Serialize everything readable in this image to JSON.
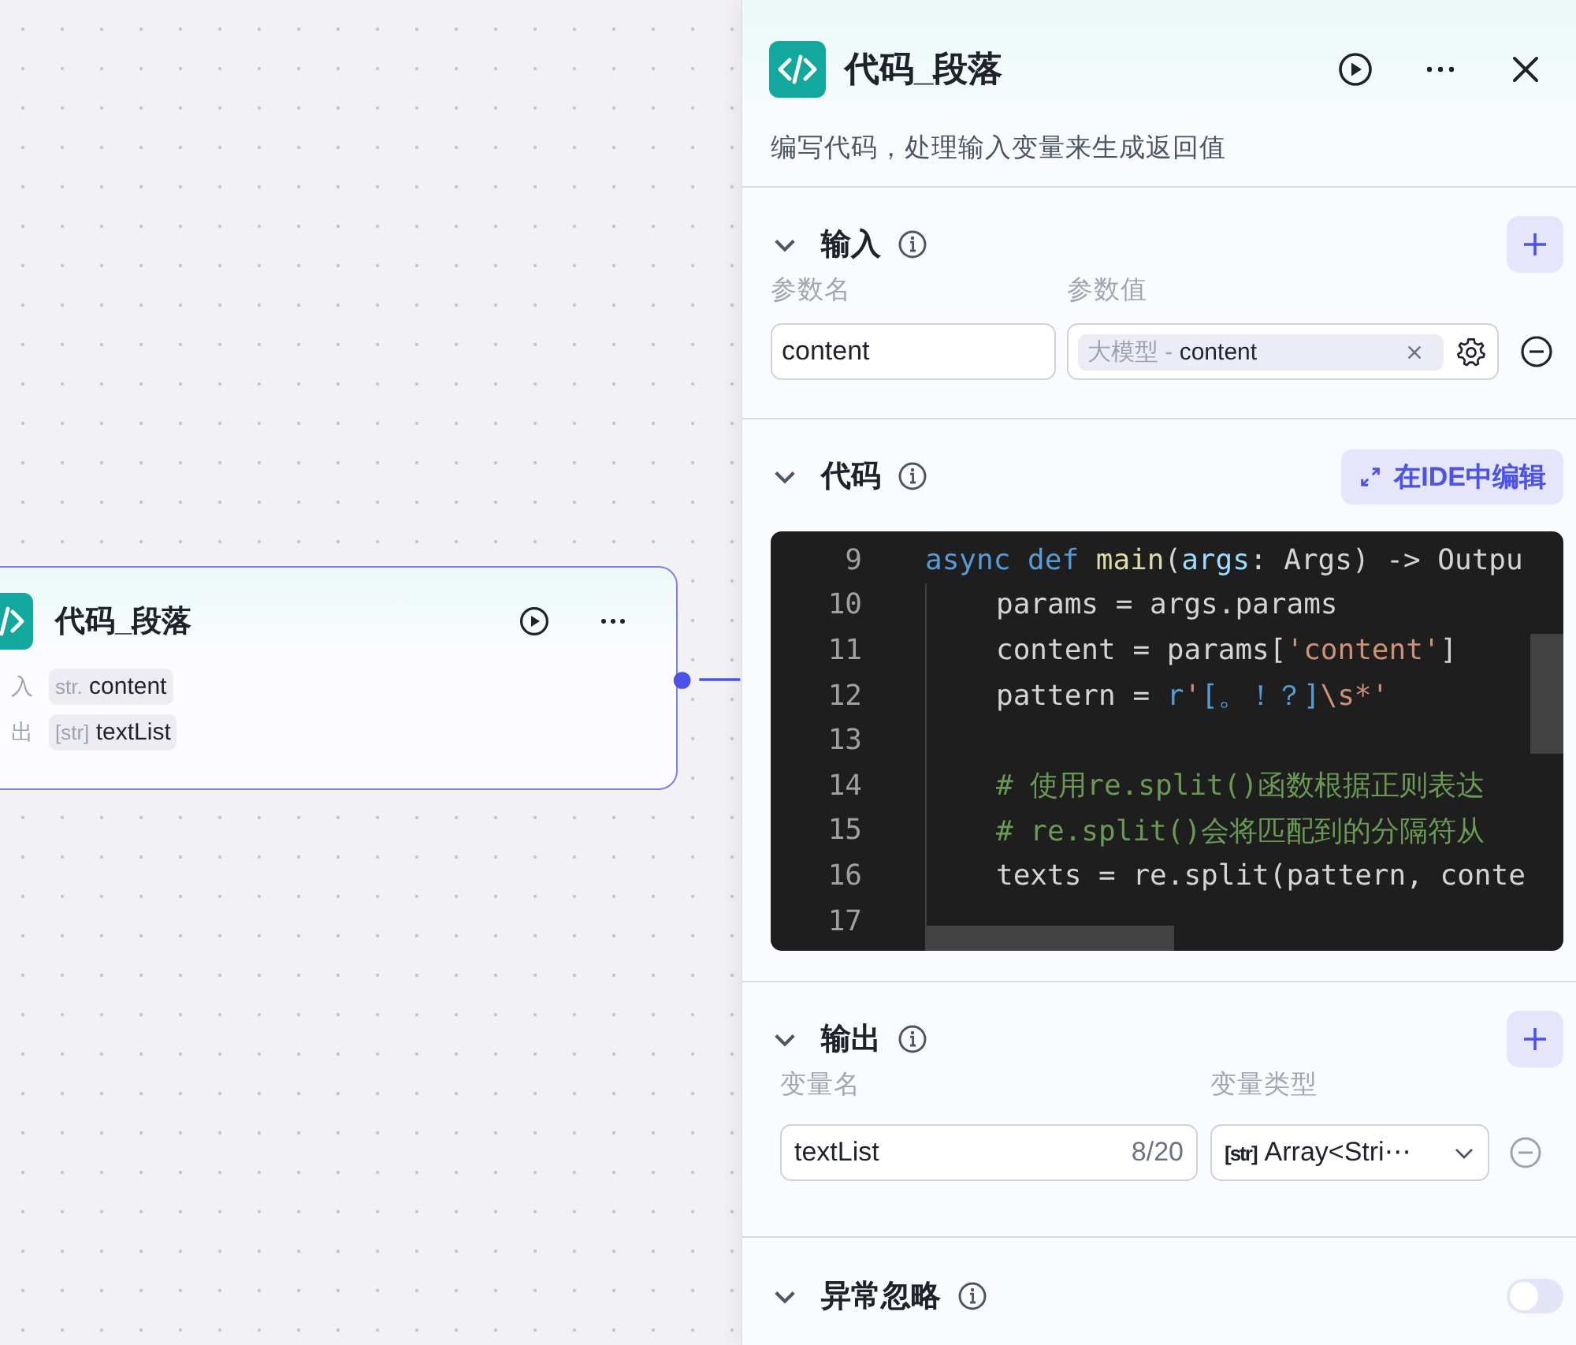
{
  "canvas": {
    "node": {
      "title": "代码_段落",
      "ports": [
        {
          "label": "入",
          "type": "str.",
          "name": "content"
        },
        {
          "label": "出",
          "type": "[str]",
          "name": "textList"
        }
      ]
    }
  },
  "panel": {
    "title": "代码_段落",
    "description": "编写代码，处理输入变量来生成返回值",
    "input": {
      "title": "输入",
      "expanded": true,
      "columns": [
        "参数名",
        "参数值"
      ],
      "params": [
        {
          "name": "content",
          "source": "大模型",
          "separator": "-",
          "value": "content"
        }
      ]
    },
    "code": {
      "title": "代码",
      "expanded": true,
      "ide_button": "在IDE中编辑",
      "lines": [
        {
          "number": "9",
          "indented": false,
          "tokens": [
            {
              "text": "async def ",
              "kind": "keyword"
            },
            {
              "text": "main",
              "kind": "function"
            },
            {
              "text": "(",
              "kind": "plain"
            },
            {
              "text": "args",
              "kind": "param"
            },
            {
              "text": ": Args) -> Outpu",
              "kind": "plain"
            }
          ]
        },
        {
          "number": "10",
          "indented": true,
          "tokens": [
            {
              "text": "params = args.params",
              "kind": "plain"
            }
          ]
        },
        {
          "number": "11",
          "indented": true,
          "tokens": [
            {
              "text": "content = params[",
              "kind": "plain"
            },
            {
              "text": "'content'",
              "kind": "string"
            },
            {
              "text": "]",
              "kind": "plain"
            }
          ]
        },
        {
          "number": "12",
          "indented": true,
          "tokens": [
            {
              "text": "pattern = ",
              "kind": "plain"
            },
            {
              "text": "r",
              "kind": "keyword"
            },
            {
              "text": "'",
              "kind": "string"
            },
            {
              "text": "[。！？]",
              "kind": "keyword"
            },
            {
              "text": "\\s*'",
              "kind": "string"
            }
          ]
        },
        {
          "number": "13",
          "indented": true
        },
        {
          "number": "14",
          "indented": true,
          "tokens": [
            {
              "text": "# 使用re.split()函数根据正则表达",
              "kind": "comment"
            }
          ]
        },
        {
          "number": "15",
          "indented": true,
          "tokens": [
            {
              "text": "# re.split()会将匹配到的分隔符从",
              "kind": "comment"
            }
          ]
        },
        {
          "number": "16",
          "indented": true,
          "tokens": [
            {
              "text": "texts = re.split(pattern, conte",
              "kind": "plain"
            }
          ]
        },
        {
          "number": "17",
          "indented": true
        }
      ]
    },
    "output": {
      "title": "输出",
      "expanded": true,
      "columns": [
        "变量名",
        "变量类型"
      ],
      "vars": [
        {
          "name": "textList",
          "count": "8/20",
          "type_tag": "[str]",
          "type": "Array<Stri⋯"
        }
      ]
    },
    "ignore_errors": {
      "title": "异常忽略",
      "expanded": true,
      "on": false
    }
  }
}
